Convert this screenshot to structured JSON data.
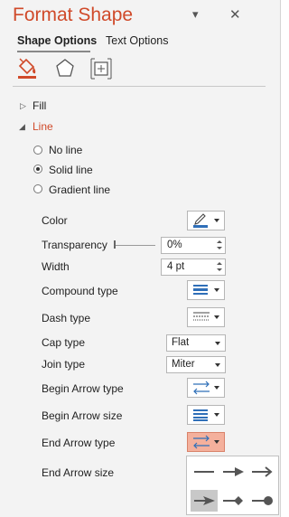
{
  "panel": {
    "title": "Format Shape",
    "collapse_icon": "chevron-down-icon",
    "close_icon": "close-icon",
    "close_glyph": "✕",
    "collapse_glyph": "▾"
  },
  "tabs": [
    {
      "label": "Shape Options",
      "active": true
    },
    {
      "label": "Text Options",
      "active": false
    }
  ],
  "icon_tabs": [
    "fill-line-icon",
    "effects-pentagon-icon",
    "size-properties-icon"
  ],
  "sections": {
    "fill": {
      "label": "Fill",
      "expanded": false,
      "glyph": "▷"
    },
    "line": {
      "label": "Line",
      "expanded": true,
      "glyph": "◢"
    }
  },
  "line_options": [
    {
      "label": "No line",
      "selected": false
    },
    {
      "label": "Solid line",
      "selected": true
    },
    {
      "label": "Gradient line",
      "selected": false
    }
  ],
  "properties": {
    "color": {
      "label": "Color"
    },
    "transparency": {
      "label": "Transparency",
      "value": "0%"
    },
    "width": {
      "label": "Width",
      "value": "4 pt"
    },
    "compound_type": {
      "label": "Compound type"
    },
    "dash_type": {
      "label": "Dash type"
    },
    "cap_type": {
      "label": "Cap type",
      "value": "Flat"
    },
    "join_type": {
      "label": "Join type",
      "value": "Miter"
    },
    "begin_arrow_type": {
      "label": "Begin Arrow type"
    },
    "begin_arrow_size": {
      "label": "Begin Arrow size"
    },
    "end_arrow_type": {
      "label": "End Arrow type",
      "open": true
    },
    "end_arrow_size": {
      "label": "End Arrow size"
    }
  },
  "arrow_gallery": [
    {
      "name": "no-arrow-icon",
      "selected": false
    },
    {
      "name": "arrow-icon",
      "selected": false
    },
    {
      "name": "open-arrow-icon",
      "selected": false
    },
    {
      "name": "stealth-arrow-icon",
      "selected": true
    },
    {
      "name": "diamond-arrow-icon",
      "selected": false
    },
    {
      "name": "oval-arrow-icon",
      "selected": false
    }
  ],
  "colors": {
    "accent": "#d04a2a",
    "selected_button": "#f4b09c",
    "icon_blue": "#2f6fb8"
  }
}
